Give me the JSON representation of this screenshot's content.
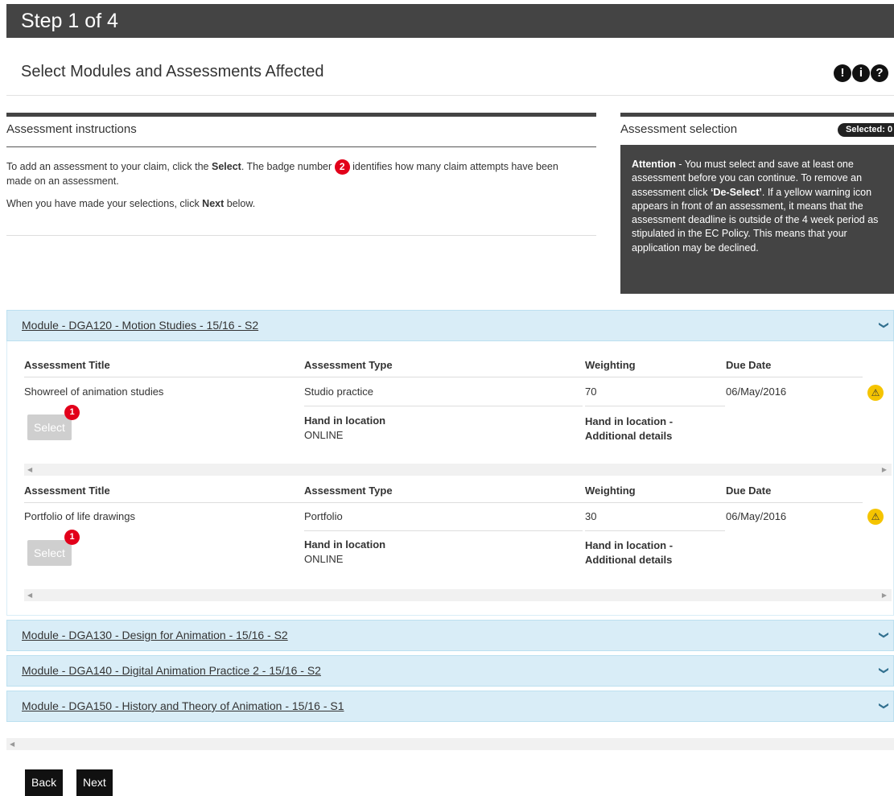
{
  "header": {
    "step": "Step 1 of 4",
    "title": "Select Modules and Assessments Affected"
  },
  "help_icons": [
    "!",
    "i",
    "?"
  ],
  "instructions": {
    "heading": "Assessment instructions",
    "line1_a": "To add an assessment to your claim, click the ",
    "line1_bold": "Select",
    "line1_b": ". The badge number ",
    "badge": "2",
    "line1_c": " identifies how many claim attempts have been made on an assessment.",
    "line2_a": "When you have made your selections, click ",
    "line2_bold": "Next",
    "line2_b": " below."
  },
  "selection": {
    "heading": "Assessment selection",
    "badge": "Selected: 0",
    "attention_bold": "Attention",
    "attention_a": " - You must select and save at least one assessment before you can continue. To remove an assessment click ",
    "attention_quote": "‘De-Select’",
    "attention_b": ". If a yellow warning icon appears in front of an assessment, it means that the assessment deadline is outside of the 4 week period as stipulated in the EC Policy. This means that your application may be declined."
  },
  "columns": {
    "title": "Assessment Title",
    "type": "Assessment Type",
    "weighting": "Weighting",
    "due": "Due Date",
    "hand": "Hand in location",
    "hand_extra": "Hand in location - Additional details"
  },
  "modules": [
    {
      "label": "Module - DGA120 - Motion Studies - 15/16 - S2"
    },
    {
      "label": "Module - DGA130 - Design for Animation - 15/16 - S2"
    },
    {
      "label": "Module - DGA140 - Digital Animation Practice 2 - 15/16 - S2"
    },
    {
      "label": "Module - DGA150 - History and Theory of Animation - 15/16 - S1"
    }
  ],
  "assessments": [
    {
      "title": "Showreel of animation studies",
      "type": "Studio practice",
      "weighting": "70",
      "due": "06/May/2016",
      "hand": "ONLINE",
      "attempts": "1",
      "select_label": "Select"
    },
    {
      "title": "Portfolio of life drawings",
      "type": "Portfolio",
      "weighting": "30",
      "due": "06/May/2016",
      "hand": "ONLINE",
      "attempts": "1",
      "select_label": "Select"
    }
  ],
  "footer": {
    "back": "Back",
    "next": "Next"
  }
}
